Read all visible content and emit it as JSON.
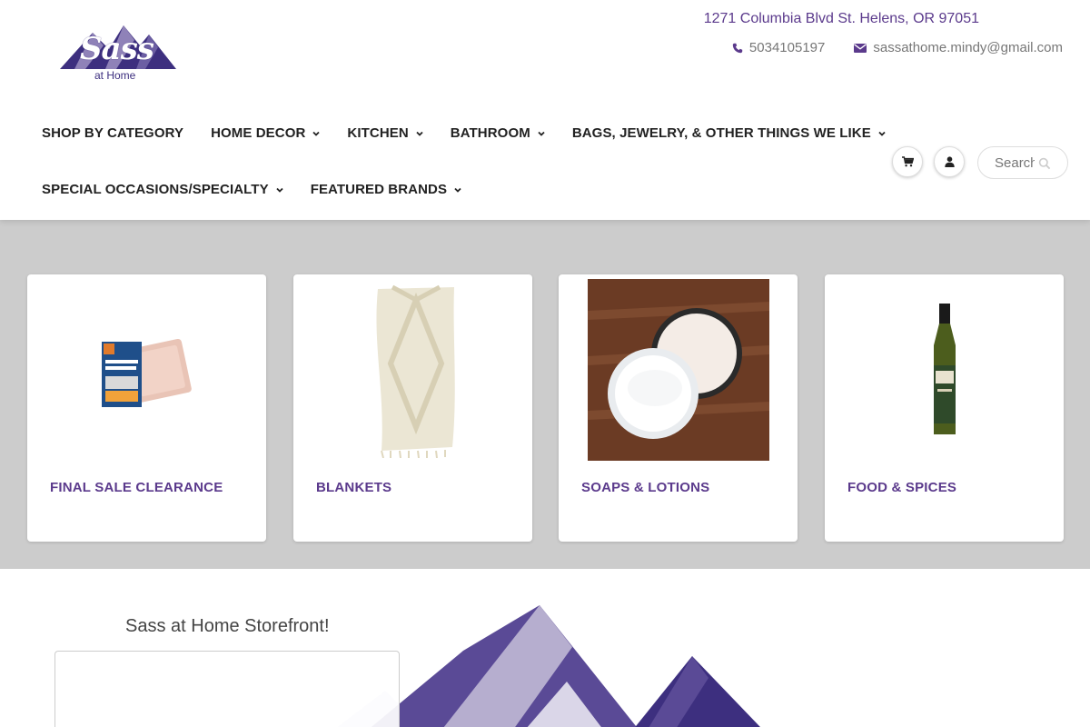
{
  "brand": {
    "logo_script": "Sass",
    "logo_sub": "at Home",
    "colors": {
      "primary": "#5b3a8c",
      "logo_dark": "#3d2f7f",
      "logo_light": "#8f82b8",
      "band_bg": "#cccccc"
    }
  },
  "contact": {
    "address": "1271 Columbia Blvd St. Helens, OR 97051",
    "phone": "5034105197",
    "email": "sassathome.mindy@gmail.com",
    "phone_icon": "phone-icon",
    "email_icon": "envelope-icon"
  },
  "nav": {
    "row1": [
      {
        "label": "SHOP BY CATEGORY",
        "dropdown": false
      },
      {
        "label": "HOME DECOR",
        "dropdown": true
      },
      {
        "label": "KITCHEN",
        "dropdown": true
      },
      {
        "label": "BATHROOM",
        "dropdown": true
      },
      {
        "label": "BAGS, JEWELRY, & OTHER THINGS WE LIKE",
        "dropdown": true
      }
    ],
    "row2": [
      {
        "label": "SPECIAL OCCASIONS/SPECIALTY",
        "dropdown": true
      },
      {
        "label": "FEATURED BRANDS",
        "dropdown": true
      }
    ]
  },
  "tools": {
    "cart_icon": "shopping-cart-icon",
    "account_icon": "user-icon",
    "search_placeholder": "Search",
    "search_icon": "search-icon"
  },
  "categories": [
    {
      "label": "FINAL SALE CLEARANCE",
      "image": "soap-bar-product"
    },
    {
      "label": "BLANKETS",
      "image": "cream-blanket-product"
    },
    {
      "label": "SOAPS & LOTIONS",
      "image": "lotion-jars-product"
    },
    {
      "label": "FOOD & SPICES",
      "image": "olive-oil-bottle-product"
    }
  ],
  "storefront": {
    "title": "Sass at Home Storefront!"
  }
}
